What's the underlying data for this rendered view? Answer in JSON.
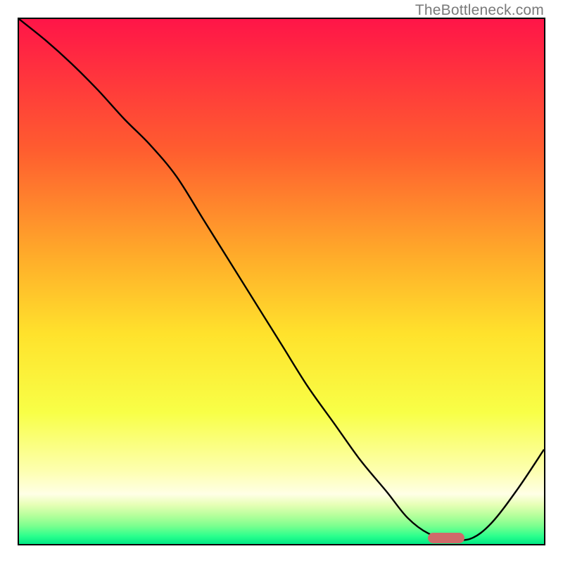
{
  "watermark": "TheBottleneck.com",
  "chart_data": {
    "type": "line",
    "title": "",
    "xlabel": "",
    "ylabel": "",
    "xlim": [
      0,
      100
    ],
    "ylim": [
      0,
      100
    ],
    "grid": false,
    "legend": false,
    "series": [
      {
        "name": "curve",
        "color": "#000000",
        "x": [
          0,
          5,
          10,
          15,
          20,
          25,
          30,
          35,
          40,
          45,
          50,
          55,
          60,
          65,
          70,
          74,
          78,
          82,
          86,
          90,
          95,
          100
        ],
        "y": [
          100,
          96,
          91.5,
          86.5,
          81,
          76,
          70,
          62,
          54,
          46,
          38,
          30,
          23,
          16,
          10,
          5,
          2,
          1,
          1,
          4,
          10.5,
          18
        ]
      }
    ],
    "annotations": [
      {
        "name": "optimal-marker",
        "shape": "pill",
        "color": "#cf6a6a",
        "x_start": 78,
        "x_end": 85,
        "y": 1,
        "height_pct": 2.0
      }
    ],
    "background_gradient": {
      "stops": [
        {
          "at": 0.0,
          "color": "#ff1548"
        },
        {
          "at": 0.25,
          "color": "#ff5d2f"
        },
        {
          "at": 0.45,
          "color": "#ffab2a"
        },
        {
          "at": 0.6,
          "color": "#ffe22c"
        },
        {
          "at": 0.75,
          "color": "#f8ff47"
        },
        {
          "at": 0.86,
          "color": "#fdffaf"
        },
        {
          "at": 0.905,
          "color": "#ffffe6"
        },
        {
          "at": 0.925,
          "color": "#e7ffb6"
        },
        {
          "at": 0.945,
          "color": "#b7ff9c"
        },
        {
          "at": 0.965,
          "color": "#7dff8f"
        },
        {
          "at": 0.985,
          "color": "#2bff8d"
        },
        {
          "at": 1.0,
          "color": "#00e884"
        }
      ]
    }
  }
}
